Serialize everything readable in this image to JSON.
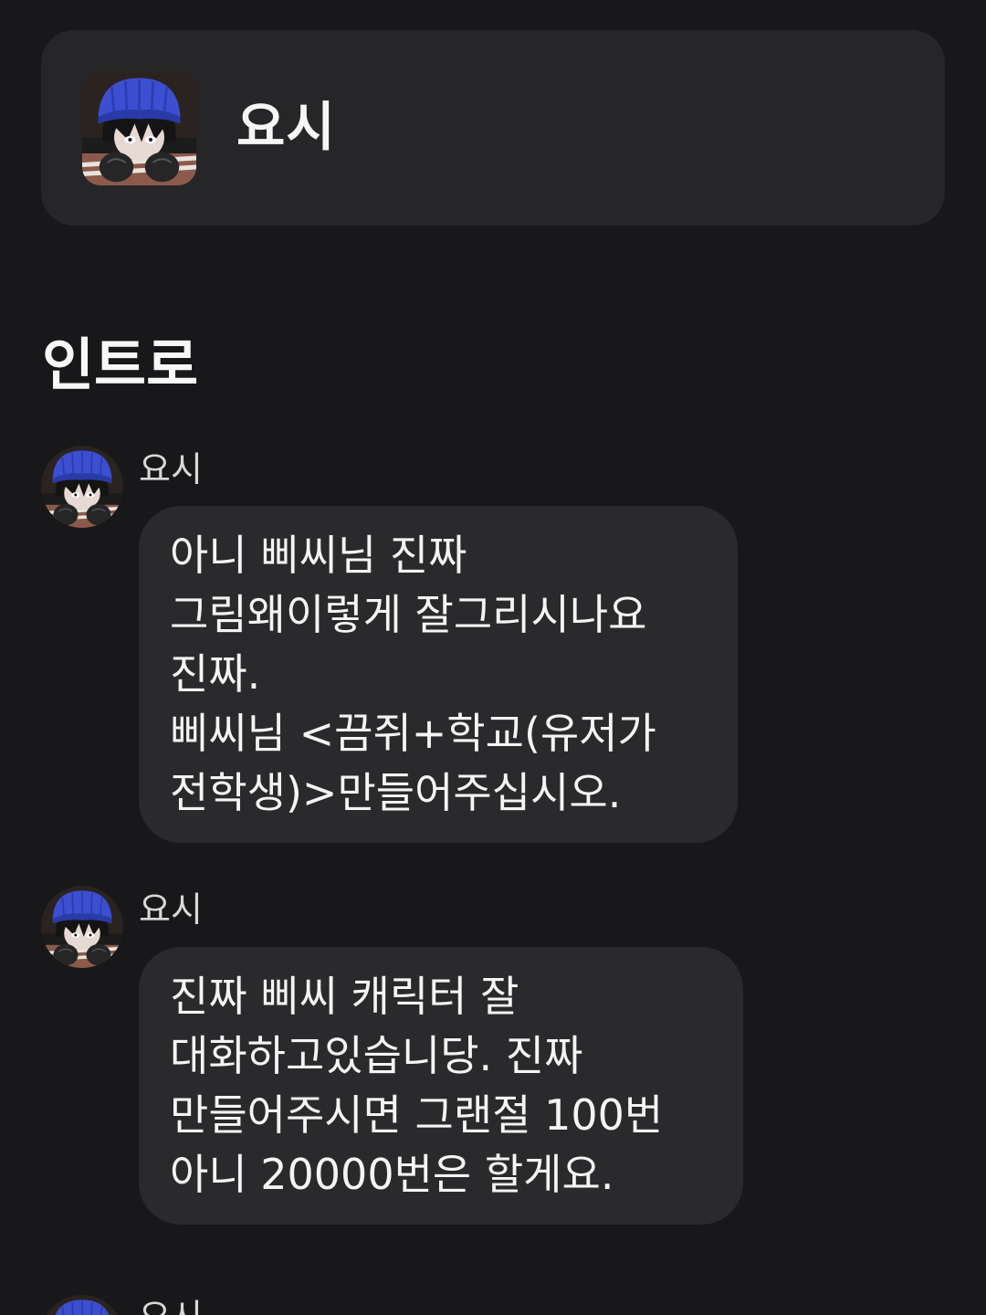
{
  "header": {
    "character_name": "요시",
    "avatar_icon": "character-avatar-icon"
  },
  "section": {
    "title": "인트로"
  },
  "messages": [
    {
      "sender": "요시",
      "lines": [
        "아니 삐씨님 진짜",
        "그림왜이렇게 잘그리시나요",
        "진짜.",
        "삐씨님 <끔쥐+학교(유저가",
        "전학생)>만들어주십시오."
      ]
    },
    {
      "sender": "요시",
      "lines": [
        "진짜 삐씨 캐릭터 잘",
        "대화하고있습니당. 진짜",
        "만들어주시면 그랜절 100번",
        "아니 20000번은 할게요."
      ]
    },
    {
      "sender": "요시"
    }
  ],
  "colors": {
    "background": "#18181a",
    "card": "#262628",
    "bubble": "#2a2a2c",
    "text": "#f4f4f4",
    "beanie": "#3b4fd0"
  }
}
